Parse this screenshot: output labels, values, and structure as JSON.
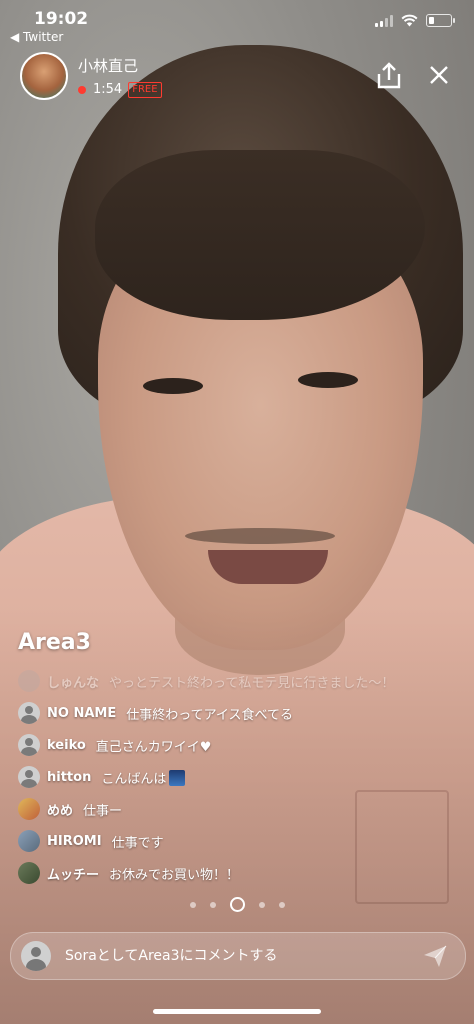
{
  "status_bar": {
    "time": "19:02",
    "back_label": "◀ Twitter"
  },
  "host": {
    "name": "小林直己",
    "elapsed": "1:54",
    "badge": "FREE"
  },
  "room_title": "Area3",
  "comments": [
    {
      "user": "しゅんな",
      "text": "やっとテスト終わって私モテ見に行きました〜！",
      "faded": true
    },
    {
      "user": "NO NAME",
      "text": "仕事終わってアイス食べてる"
    },
    {
      "user": "keiko",
      "text": "直己さんカワイイ♥"
    },
    {
      "user": "hitton",
      "text": "こんばんは"
    },
    {
      "user": "めめ",
      "text": "仕事ー"
    },
    {
      "user": "HIROMI",
      "text": "仕事です"
    },
    {
      "user": "ムッチー",
      "text": "お休みでお買い物！！"
    }
  ],
  "comment_bar": {
    "placeholder": "SoraとしてArea3にコメントする"
  },
  "icons": {
    "share": "share-icon",
    "close": "close-icon",
    "send": "send-icon",
    "live": "live-dot-icon"
  },
  "colors": {
    "live": "#ff3b30",
    "badge": "#ff3b30"
  }
}
